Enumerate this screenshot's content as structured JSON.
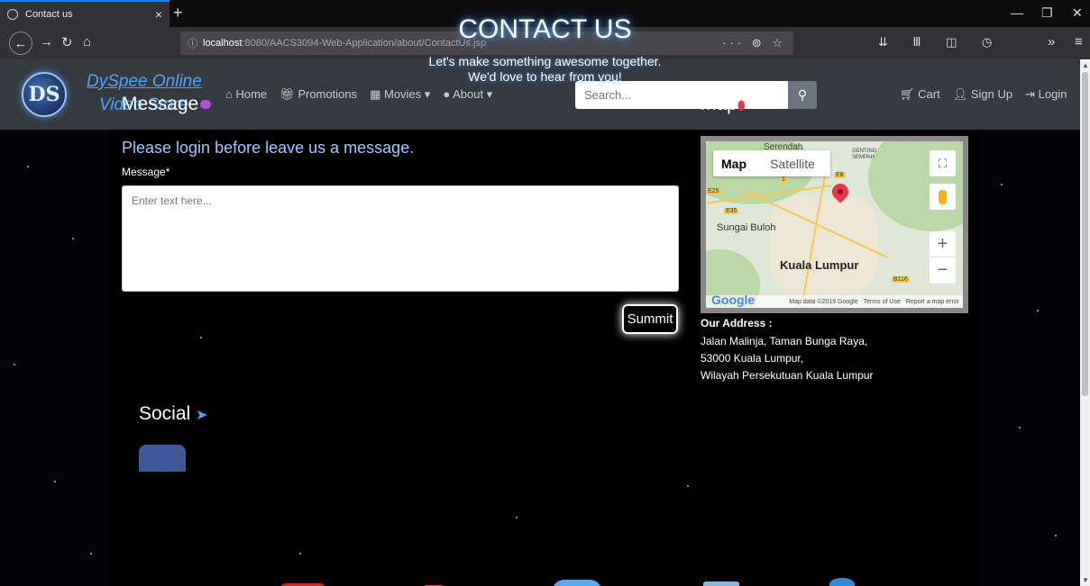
{
  "browser": {
    "tab_title": "Contact us",
    "tab_close": "×",
    "new_tab": "+",
    "url_host": "localhost",
    "url_path": ":8080/AACS3094-Web-Application/about/ContactUs.jsp",
    "url_actions": "··· ⊚ ☆",
    "toolbar_icons": "⇊ Ⅲ ◫ ◷",
    "overflow": "»",
    "menu": "≡"
  },
  "header": {
    "logo_text": "DS",
    "brand_line1": "DySpee Online",
    "brand_line2": "Video Store",
    "nav": {
      "home": "Home",
      "promotions": "Promotions",
      "movies": "Movies",
      "about": "About"
    },
    "search_placeholder": "Search...",
    "cart": "Cart",
    "signup": "Sign Up",
    "login": "Login"
  },
  "page": {
    "title": "CONTACT US",
    "subtitle_line1": "Let's make something awesome together.",
    "subtitle_line2": "We'd love to hear from you!"
  },
  "message": {
    "heading": "Message",
    "login_note": "Please login before leave us a message.",
    "label": "Message*",
    "placeholder": "Enter text here...",
    "submit_label": "Summit"
  },
  "map": {
    "heading": "Map",
    "toggle_map": "Map",
    "toggle_satellite": "Satellite",
    "zoom_in": "+",
    "zoom_out": "−",
    "labels": {
      "serendah": "Serendah",
      "genting": "GENTING SEMPAH",
      "sungai_buloh": "Sungai Buloh",
      "kuala_lumpur": "Kuala Lumpur",
      "e25": "E25",
      "e35": "E35",
      "e8": "E8",
      "b116": "B116",
      "route1": "1"
    },
    "google": "Google",
    "map_data": "Map data ©2019 Google",
    "terms": "Terms of Use",
    "report": "Report a map error"
  },
  "address": {
    "title": "Our Address :",
    "line1": "Jalan Malinja, Taman Bunga Raya,",
    "line2": "53000 Kuala Lumpur,",
    "line3": "Wilayah Persekutuan Kuala Lumpur"
  },
  "social": {
    "heading": "Social"
  },
  "colors": {
    "accent_blue": "#4ea3ff",
    "header_bg": "#343a40",
    "pin_red": "#e8374a",
    "chat_purple": "#b54ee0"
  }
}
